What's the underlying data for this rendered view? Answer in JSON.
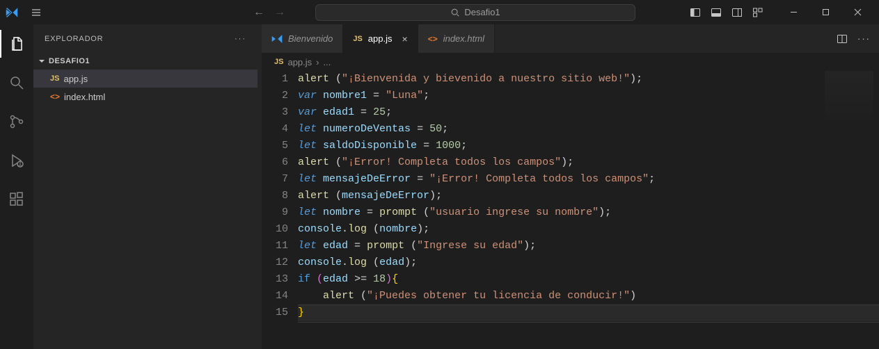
{
  "titlebar": {
    "search_text": "Desafio1"
  },
  "sidebar": {
    "title": "EXPLORADOR",
    "section": "DESAFIO1",
    "files": [
      {
        "name": "app.js",
        "icon": "js",
        "active": true
      },
      {
        "name": "index.html",
        "icon": "html",
        "active": false
      }
    ]
  },
  "tabs": [
    {
      "label": "Bienvenido",
      "icon": "vscode",
      "active": false,
      "closeable": false
    },
    {
      "label": "app.js",
      "icon": "js",
      "active": true,
      "closeable": true
    },
    {
      "label": "index.html",
      "icon": "html",
      "active": false,
      "closeable": false
    }
  ],
  "breadcrumb": {
    "file": "app.js",
    "suffix": "..."
  },
  "code": {
    "line_count": 15,
    "current_line": 15,
    "lines": [
      {
        "n": 1,
        "tokens": [
          [
            "fn",
            "alert"
          ],
          [
            "punc",
            " ("
          ],
          [
            "str",
            "\"¡Bienvenida y bievenido a nuestro sitio web!\""
          ],
          [
            "punc",
            ");"
          ]
        ]
      },
      {
        "n": 2,
        "tokens": [
          [
            "kw",
            "var"
          ],
          [
            "op",
            " "
          ],
          [
            "var",
            "nombre1"
          ],
          [
            "op",
            " = "
          ],
          [
            "str",
            "\"Luna\""
          ],
          [
            "punc",
            ";"
          ]
        ]
      },
      {
        "n": 3,
        "tokens": [
          [
            "kw",
            "var"
          ],
          [
            "op",
            " "
          ],
          [
            "var",
            "edad1"
          ],
          [
            "op",
            " = "
          ],
          [
            "num",
            "25"
          ],
          [
            "punc",
            ";"
          ]
        ]
      },
      {
        "n": 4,
        "tokens": [
          [
            "kw",
            "let"
          ],
          [
            "op",
            " "
          ],
          [
            "var",
            "numeroDeVentas"
          ],
          [
            "op",
            " = "
          ],
          [
            "num",
            "50"
          ],
          [
            "punc",
            ";"
          ]
        ]
      },
      {
        "n": 5,
        "tokens": [
          [
            "kw",
            "let"
          ],
          [
            "op",
            " "
          ],
          [
            "var",
            "saldoDisponible"
          ],
          [
            "op",
            " = "
          ],
          [
            "num",
            "1000"
          ],
          [
            "punc",
            ";"
          ]
        ]
      },
      {
        "n": 6,
        "tokens": [
          [
            "fn",
            "alert"
          ],
          [
            "punc",
            " ("
          ],
          [
            "str",
            "\"¡Error! Completa todos los campos\""
          ],
          [
            "punc",
            ");"
          ]
        ]
      },
      {
        "n": 7,
        "tokens": [
          [
            "kw",
            "let"
          ],
          [
            "op",
            " "
          ],
          [
            "var",
            "mensajeDeError"
          ],
          [
            "op",
            " = "
          ],
          [
            "str",
            "\"¡Error! Completa todos los campos\""
          ],
          [
            "punc",
            ";"
          ]
        ]
      },
      {
        "n": 8,
        "tokens": [
          [
            "fn",
            "alert"
          ],
          [
            "punc",
            " ("
          ],
          [
            "var",
            "mensajeDeError"
          ],
          [
            "punc",
            ");"
          ]
        ]
      },
      {
        "n": 9,
        "tokens": [
          [
            "kw",
            "let"
          ],
          [
            "op",
            " "
          ],
          [
            "var",
            "nombre"
          ],
          [
            "op",
            " = "
          ],
          [
            "fn",
            "prompt"
          ],
          [
            "punc",
            " ("
          ],
          [
            "str",
            "\"usuario ingrese su nombre\""
          ],
          [
            "punc",
            ");"
          ]
        ]
      },
      {
        "n": 10,
        "tokens": [
          [
            "var",
            "console"
          ],
          [
            "punc",
            "."
          ],
          [
            "fn",
            "log"
          ],
          [
            "punc",
            " ("
          ],
          [
            "var",
            "nombre"
          ],
          [
            "punc",
            ");"
          ]
        ]
      },
      {
        "n": 11,
        "tokens": [
          [
            "kw",
            "let"
          ],
          [
            "op",
            " "
          ],
          [
            "var",
            "edad"
          ],
          [
            "op",
            " = "
          ],
          [
            "fn",
            "prompt"
          ],
          [
            "punc",
            " ("
          ],
          [
            "str",
            "\"Ingrese su edad\""
          ],
          [
            "punc",
            ");"
          ]
        ]
      },
      {
        "n": 12,
        "tokens": [
          [
            "var",
            "console"
          ],
          [
            "punc",
            "."
          ],
          [
            "fn",
            "log"
          ],
          [
            "punc",
            " ("
          ],
          [
            "var",
            "edad"
          ],
          [
            "punc",
            ");"
          ]
        ]
      },
      {
        "n": 13,
        "tokens": [
          [
            "kw2",
            "if"
          ],
          [
            "op",
            " "
          ],
          [
            "brace",
            "("
          ],
          [
            "var",
            "edad"
          ],
          [
            "op",
            " >= "
          ],
          [
            "num",
            "18"
          ],
          [
            "brace",
            ")"
          ],
          [
            "brace2",
            "{"
          ]
        ]
      },
      {
        "n": 14,
        "indent": 1,
        "tokens": [
          [
            "fn",
            "alert"
          ],
          [
            "punc",
            " ("
          ],
          [
            "str",
            "\"¡Puedes obtener tu licencia de conducir!\""
          ],
          [
            "punc",
            ")"
          ]
        ]
      },
      {
        "n": 15,
        "tokens": [
          [
            "brace2",
            "}"
          ]
        ]
      }
    ]
  }
}
